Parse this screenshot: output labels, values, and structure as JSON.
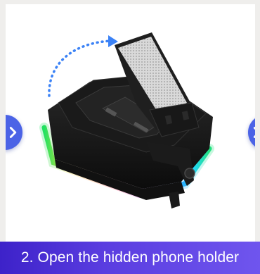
{
  "slider": {
    "caption": "2. Open the hidden phone holder",
    "prev_icon": "chevron-right-icon",
    "next_icon": "chevron-right-icon"
  },
  "colors": {
    "caption_bar_start": "#3d22c9",
    "caption_bar_end": "#6f55ee",
    "nav_button": "#4b63e6",
    "arrow": "#3b82f6",
    "background": "#efeeec"
  },
  "image": {
    "icon": "phone-holder-speaker-product-image"
  }
}
